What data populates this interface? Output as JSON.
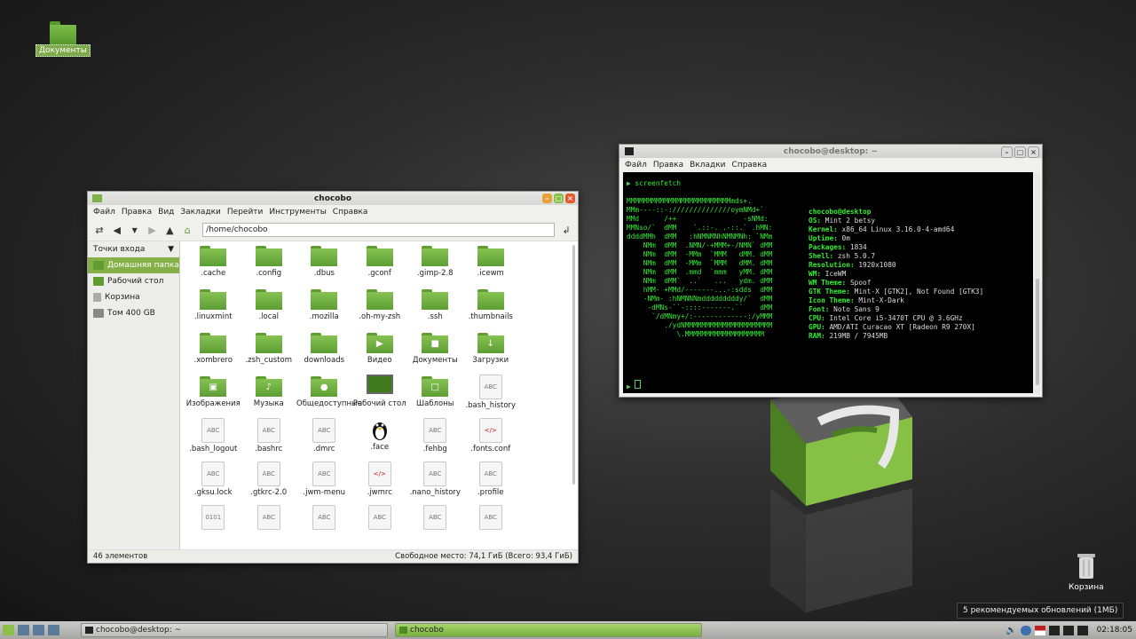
{
  "desktop": {
    "documents_label": "Документы",
    "trash_label": "Корзина"
  },
  "file_manager": {
    "title": "chocobo",
    "menu": [
      "Файл",
      "Правка",
      "Вид",
      "Закладки",
      "Перейти",
      "Инструменты",
      "Справка"
    ],
    "path": "/home/chocobo",
    "sidebar_header": "Точки входа",
    "sidebar": [
      "Домашняя папка",
      "Рабочий стол",
      "Корзина",
      "Том 400 GB"
    ],
    "files": [
      ".cache",
      ".config",
      ".dbus",
      ".gconf",
      ".gimp-2.8",
      ".icewm",
      ".linuxmint",
      ".local",
      ".mozilla",
      ".oh-my-zsh",
      ".ssh",
      ".thumbnails",
      ".xombrero",
      ".zsh_custom",
      "downloads",
      "Видео",
      "Документы",
      "Загрузки",
      "Изображения",
      "Музыка",
      "Общедоступные",
      "Рабочий стол",
      "Шаблоны",
      ".bash_history",
      ".bash_logout",
      ".bashrc",
      ".dmrc",
      ".face",
      ".fehbg",
      ".fonts.conf",
      ".gksu.lock",
      ".gtkrc-2.0",
      ".jwm-menu",
      ".jwmrc",
      ".nano_history",
      ".profile",
      "",
      "",
      "",
      "",
      "",
      ""
    ],
    "status_left": "46 элементов",
    "status_right": "Свободное место: 74,1 ГиБ (Всего: 93,4 ГиБ)"
  },
  "terminal": {
    "title": "chocobo@desktop: ~",
    "menu": [
      "Файл",
      "Правка",
      "Вкладки",
      "Справка"
    ],
    "command": "screenfetch",
    "user_host": "chocobo@desktop",
    "info": [
      {
        "k": "OS:",
        "v": " Mint 2 betsy"
      },
      {
        "k": "Kernel:",
        "v": " x86_64 Linux 3.16.0-4-amd64"
      },
      {
        "k": "Uptime:",
        "v": " 0m"
      },
      {
        "k": "Packages:",
        "v": " 1834"
      },
      {
        "k": "Shell:",
        "v": " zsh 5.0.7"
      },
      {
        "k": "Resolution:",
        "v": " 1920x1080"
      },
      {
        "k": "WM:",
        "v": " IceWM"
      },
      {
        "k": "WM Theme:",
        "v": " Spoof"
      },
      {
        "k": "GTK Theme:",
        "v": " Mint-X [GTK2], Not Found [GTK3]"
      },
      {
        "k": "Icon Theme:",
        "v": " Mint-X-Dark"
      },
      {
        "k": "Font:",
        "v": " Noto Sans 9"
      },
      {
        "k": "CPU:",
        "v": " Intel Core i5-3470T CPU @ 3.6GHz"
      },
      {
        "k": "GPU:",
        "v": " AMD/ATI Curacao XT [Radeon R9 270X]"
      },
      {
        "k": "RAM:",
        "v": " 219MB / 7945MB"
      }
    ],
    "ascii_logo": "MMMMMMMMMMMMMMMMMMMMMMMMMmds+.\nMMm----::-://////////////oymNMd+`\nMMd      /++                -sNMd:\nMMNso/`  dMM    `.::-. .-::.` .hMN:\nddddMMh  dMM   :hNMNMNhNMNMNh: `NMm\n    NMm  dMM  .NMN/-+MMM+-/NMN` dMM\n    NMm  dMM  -MMm  `MMM   dMM. dMM\n    NMm  dMM  -MMm  `MMM   dMM. dMM\n    NMm  dMM  .mmd  `mmm   yMM. dMM\n    NMm  dMM`  ..`   ...   ydm. dMM\n    hMM- +MMd/-------...-:sdds  dMM\n    -NMm- :hNMNNNmdddddddddy/`  dMM\n     -dMNs-``-::::-------.``    dMM\n      `/dMNmy+/:-------------:/yMMM\n         ./ydNMMMMMMMMMMMMMMMMMMMMM\n            \\.MMMMMMMMMMMMMMMMMMM"
  },
  "taskbar": {
    "task_terminal": "chocobo@desktop: ~",
    "task_fm": "chocobo",
    "clock": "02:18:05",
    "tooltip": "5 рекомендуемых обновлений (1МБ)"
  }
}
